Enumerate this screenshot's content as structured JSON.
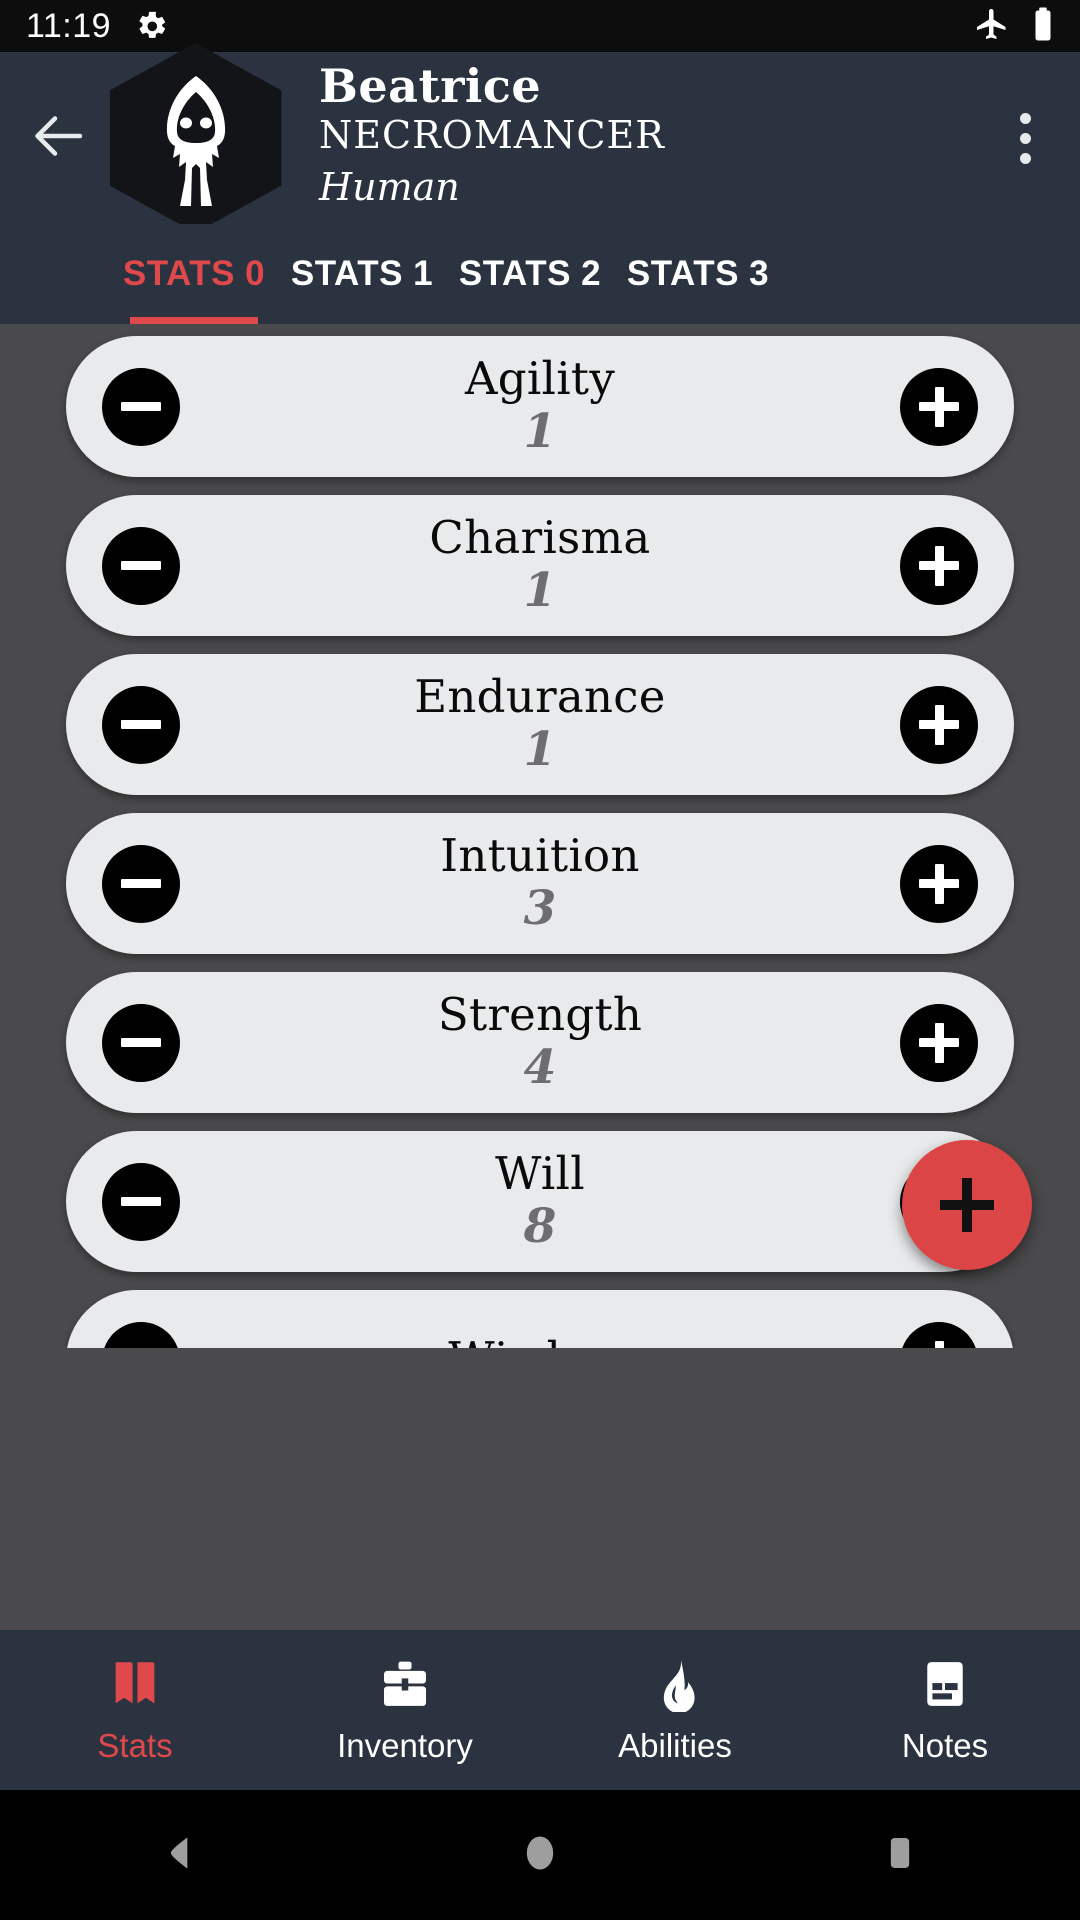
{
  "statusbar": {
    "time": "11:19",
    "gear_icon": "gear-icon",
    "airplane_icon": "airplane-mode-icon",
    "battery_icon": "battery-icon"
  },
  "header": {
    "back_icon": "back-arrow-icon",
    "avatar_icon": "hooded-figure-avatar",
    "name": "Beatrice",
    "class": "NECROMANCER",
    "race": "Human",
    "overflow_icon": "overflow-menu-icon"
  },
  "tabs": {
    "active_index": 0,
    "items": [
      {
        "label": "STATS 0"
      },
      {
        "label": "STATS 1"
      },
      {
        "label": "STATS 2"
      },
      {
        "label": "STATS 3"
      }
    ]
  },
  "stats": {
    "decrement_label": "−",
    "increment_label": "+",
    "items": [
      {
        "label": "Agility",
        "value": "1"
      },
      {
        "label": "Charisma",
        "value": "1"
      },
      {
        "label": "Endurance",
        "value": "1"
      },
      {
        "label": "Intuition",
        "value": "3"
      },
      {
        "label": "Strength",
        "value": "4"
      },
      {
        "label": "Will",
        "value": "8"
      },
      {
        "label": "Wisdom",
        "value": ""
      }
    ]
  },
  "fab": {
    "icon": "plus-icon",
    "label": "+"
  },
  "bottomnav": {
    "active_index": 0,
    "items": [
      {
        "label": "Stats",
        "icon": "book-icon"
      },
      {
        "label": "Inventory",
        "icon": "briefcase-icon"
      },
      {
        "label": "Abilities",
        "icon": "flame-icon"
      },
      {
        "label": "Notes",
        "icon": "notes-card-icon"
      }
    ]
  },
  "androidnav": {
    "back_icon": "android-back-icon",
    "home_icon": "android-home-icon",
    "recents_icon": "android-recents-icon"
  },
  "colors": {
    "accent_red": "#e0494b",
    "fab_red": "#dc4545",
    "header_navy": "#2b3340",
    "content_gray": "#4a4a4c",
    "card_gray": "#e8eaec",
    "value_gray": "#6e6e70"
  }
}
